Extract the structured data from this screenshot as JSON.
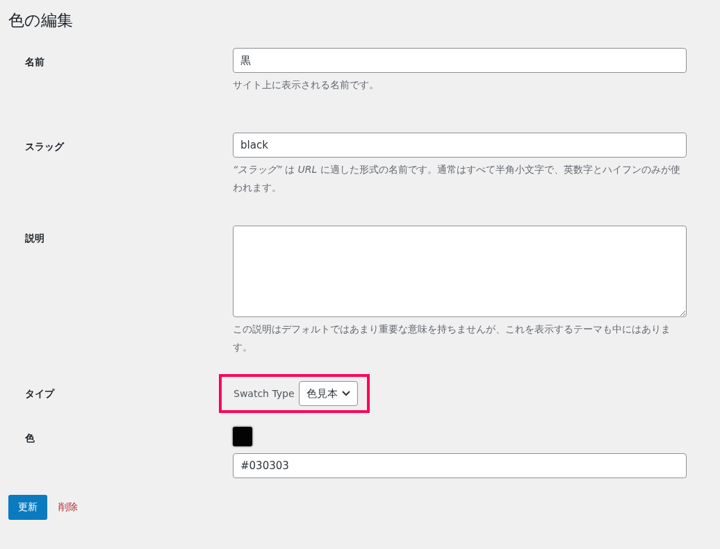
{
  "title": "色の編集",
  "fields": [
    {
      "kind": "text",
      "label": "名前",
      "value": "黒",
      "description": "サイト上に表示される名前です。"
    },
    {
      "kind": "text",
      "label": "スラッグ",
      "value": "black",
      "description": "*“スラッグ”* は *URL* に適した形式の名前です。通常はすべて半角小文字で、英数字とハイフンのみが使われます。"
    },
    {
      "kind": "textarea",
      "label": "説明",
      "description": "この説明はデフォルトではあまり重要な意味を持ちませんが、これを表示するテーマも中にはあります。"
    },
    {
      "kind": "select",
      "label": "タイプ",
      "select_label": "Swatch Type",
      "value": "色見本",
      "highlighted": true
    },
    {
      "kind": "color",
      "label": "色",
      "value": "#030303",
      "color": "#030303"
    }
  ],
  "buttons": [
    {
      "kind": "primary",
      "label": "更新"
    },
    {
      "kind": "delete",
      "label": "削除"
    }
  ]
}
